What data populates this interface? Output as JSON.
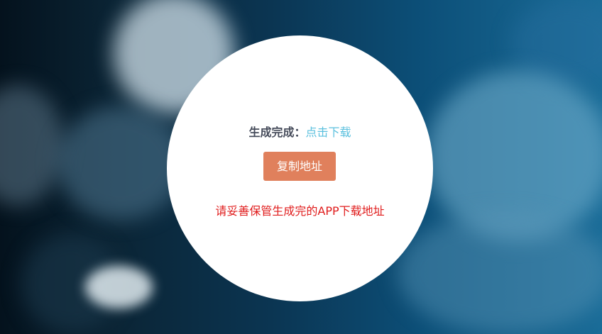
{
  "result": {
    "status_label": "生成完成：",
    "download_link": "点击下载"
  },
  "actions": {
    "copy_label": "复制地址"
  },
  "notice": {
    "text": "请妥善保管生成完的APP下载地址"
  },
  "colors": {
    "link": "#5bc0de",
    "button": "#e0805c",
    "notice": "#e01b1b",
    "label": "#464c5b"
  }
}
